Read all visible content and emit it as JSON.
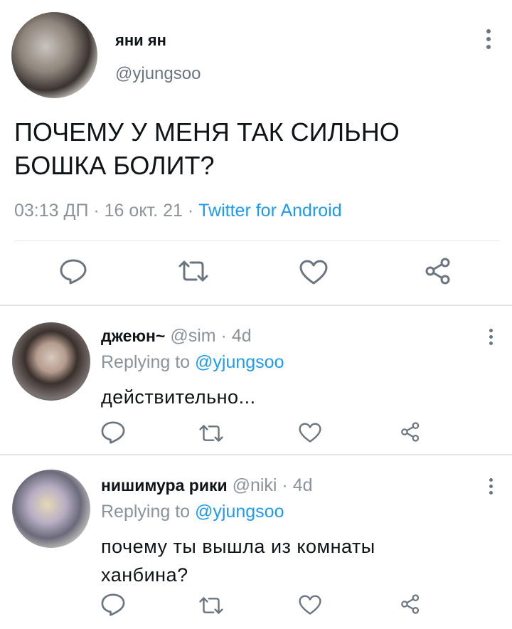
{
  "main_tweet": {
    "author_name": "яни ян",
    "author_handle": "@yjungsoo",
    "text_line1": "ПОЧЕМУ У МЕНЯ ТАК СИЛЬНО",
    "text_line2": "БОШКА БОЛИТ?",
    "time": "03:13 ДП",
    "date": "16 окт. 21",
    "separator": "·",
    "source": "Twitter for Android"
  },
  "replies": [
    {
      "author_name": "джеюн~",
      "author_handle": "@sim",
      "age": "4d",
      "replying_label": "Replying to",
      "replying_to": "@yjungsoo",
      "text_line1": "действительно...",
      "text_line2": ""
    },
    {
      "author_name": "нишимура рики",
      "author_handle": "@niki",
      "age": "4d",
      "replying_label": "Replying to",
      "replying_to": "@yjungsoo",
      "text_line1": "почему ты вышла из комнаты",
      "text_line2": "ханбина?"
    }
  ],
  "icons": [
    "reply-icon",
    "retweet-icon",
    "like-icon",
    "share-icon",
    "more-options-icon"
  ],
  "colors": {
    "text": "#0f1419",
    "secondary": "#8a939b",
    "accent": "#1d9bf0",
    "divider": "#e6e6e6",
    "icon": "#6b7580"
  }
}
